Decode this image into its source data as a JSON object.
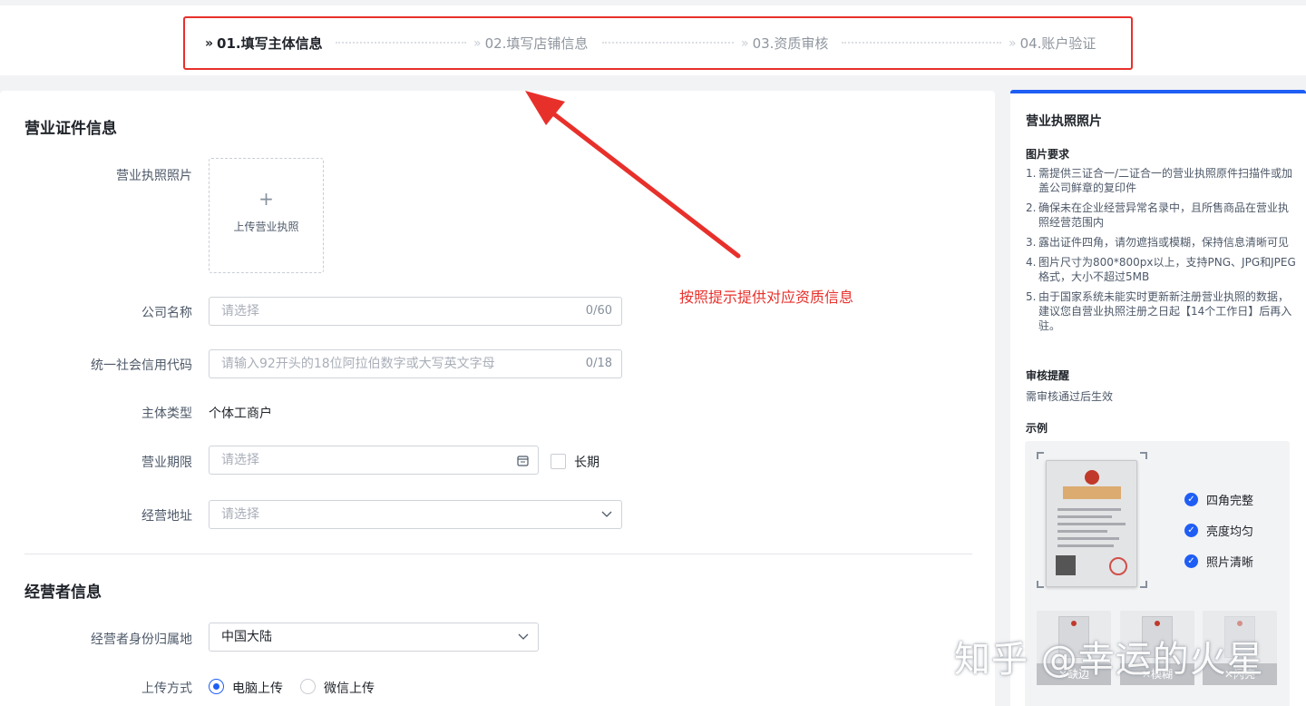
{
  "stepper": {
    "steps": [
      {
        "chev": "»",
        "label": "01.填写主体信息",
        "active": true
      },
      {
        "chev": "»",
        "label": "02.填写店铺信息",
        "active": false
      },
      {
        "chev": "»",
        "label": "03.资质审核",
        "active": false
      },
      {
        "chev": "»",
        "label": "04.账户验证",
        "active": false
      }
    ]
  },
  "license_section": {
    "title": "营业证件信息",
    "photo_label": "营业执照照片",
    "upload_plus": "+",
    "upload_text": "上传营业执照",
    "company_label": "公司名称",
    "company_placeholder": "请选择",
    "company_count": "0/60",
    "credit_label": "统一社会信用代码",
    "credit_placeholder": "请输入92开头的18位阿拉伯数字或大写英文字母",
    "credit_count": "0/18",
    "entity_label": "主体类型",
    "entity_value": "个体工商户",
    "term_label": "营业期限",
    "term_placeholder": "请选择",
    "term_icon": "calendar-icon",
    "long_term_label": "长期",
    "address_label": "经营地址",
    "address_placeholder": "请选择",
    "address_icon": "chevron-down-icon"
  },
  "operator_section": {
    "title": "经营者信息",
    "region_label": "经营者身份归属地",
    "region_value": "中国大陆",
    "upload_method_label": "上传方式",
    "method_pc": "电脑上传",
    "method_wechat": "微信上传"
  },
  "annotation": {
    "text": "按照提示提供对应资质信息",
    "color": "#e8302b"
  },
  "side_panel": {
    "title": "营业执照照片",
    "requirements_title": "图片要求",
    "requirements": [
      {
        "num": "1.",
        "text": "需提供三证合一/二证合一的营业执照原件扫描件或加盖公司鲜章的复印件"
      },
      {
        "num": "2.",
        "text": "确保未在企业经营异常名录中，且所售商品在营业执照经营范围内"
      },
      {
        "num": "3.",
        "text": "露出证件四角，请勿遮挡或模糊，保持信息清晰可见"
      },
      {
        "num": "4.",
        "text": "图片尺寸为800*800px以上，支持PNG、JPG和JPEG格式，大小不超过5MB"
      },
      {
        "num": "5.",
        "text": "由于国家系统未能实时更新新注册营业执照的数据，建议您自营业执照注册之日起【14个工作日】后再入驻。"
      }
    ],
    "review_title": "审核提醒",
    "review_note": "需审核通过后生效",
    "example_title": "示例",
    "checks": [
      "四角完整",
      "亮度均匀",
      "照片清晰"
    ],
    "check_icon": "✓",
    "thumbs": [
      "✕缺边",
      "✕模糊",
      "✕闪亮"
    ]
  },
  "watermark": "知乎 @幸运的火星",
  "colors": {
    "accent": "#1f5ef5",
    "highlight_border": "#e8302b"
  }
}
